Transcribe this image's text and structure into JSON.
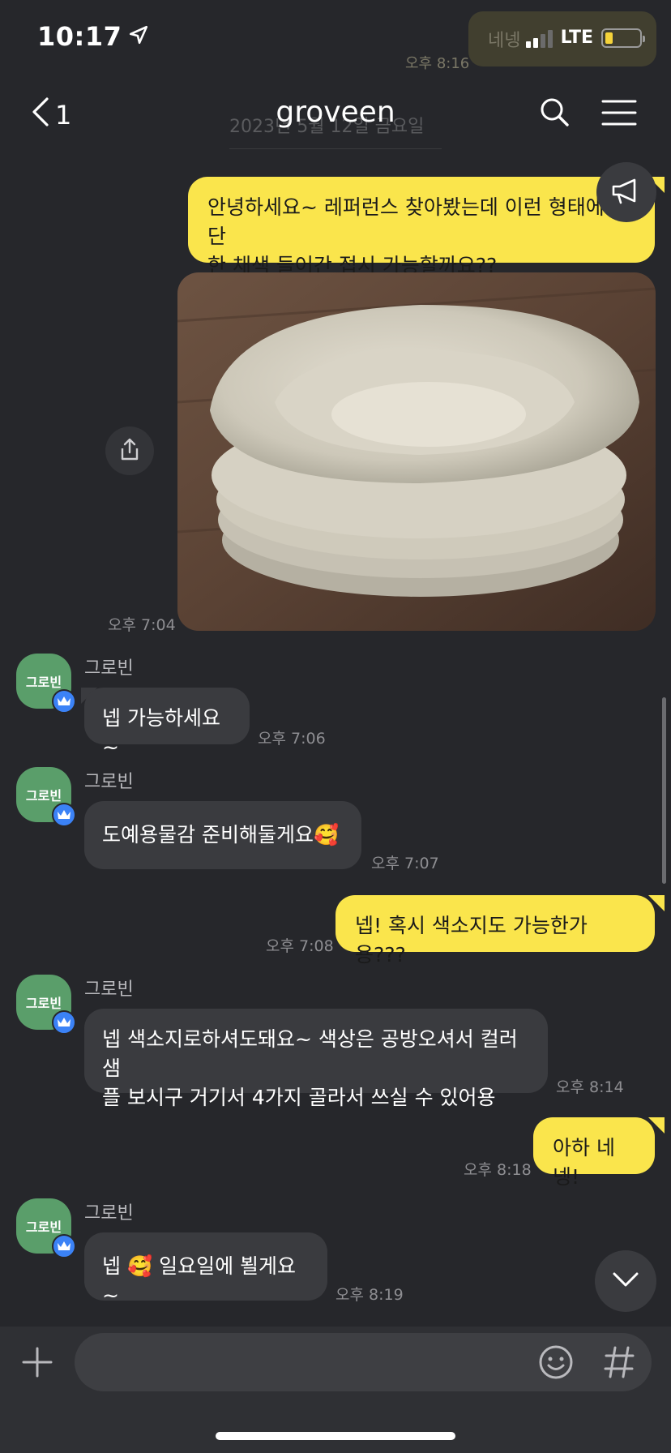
{
  "status": {
    "time": "10:17",
    "network": "LTE"
  },
  "ghost": {
    "bubble_text": "네넹",
    "time": "오후 8:16",
    "date": "2023년 5월 12일 금요일"
  },
  "header": {
    "back_count": "1",
    "title": "groveen"
  },
  "messages": {
    "m1": {
      "text_line1": "안녕하세요~ 레퍼런스 찾아봤는데 이런 형태에 간단",
      "text_line2": "한 채색 들어간 접시 가능할까요??"
    },
    "photo_time": "오후 7:04",
    "m2": {
      "sender": "그로빈",
      "text": "넵 가능하세요~",
      "time": "오후 7:06"
    },
    "m3": {
      "sender": "그로빈",
      "text": "도예용물감 준비해둘게요",
      "emoji": "🥰",
      "time": "오후 7:07"
    },
    "m4": {
      "text": "넵! 혹시 색소지도 가능한가용???",
      "time": "오후 7:08"
    },
    "m5": {
      "sender": "그로빈",
      "text_line1": "넵 색소지로하셔도돼요~ 색상은 공방오셔서 컬러샘",
      "text_line2": "플 보시구 거기서 4가지 골라서 쓰실 수 있어용",
      "time": "오후 8:14"
    },
    "m6": {
      "text": "아하 네넹!",
      "time": "오후 8:18"
    },
    "m7": {
      "sender": "그로빈",
      "text_a": "넵",
      "emoji": "🥰",
      "text_b": "일요일에 뵐게요~",
      "time": "오후 8:19"
    }
  },
  "avatar_label": "그로빈",
  "icons": [
    "location-arrow-icon",
    "back-chevron-icon",
    "search-icon",
    "menu-icon",
    "megaphone-icon",
    "share-icon",
    "crown-icon",
    "chevron-down-icon",
    "plus-icon",
    "emoji-icon",
    "hashtag-icon"
  ],
  "colors": {
    "background": "#26272b",
    "my_bubble": "#fae54c",
    "other_bubble": "#3a3b3f",
    "avatar": "#5a9e6a"
  }
}
